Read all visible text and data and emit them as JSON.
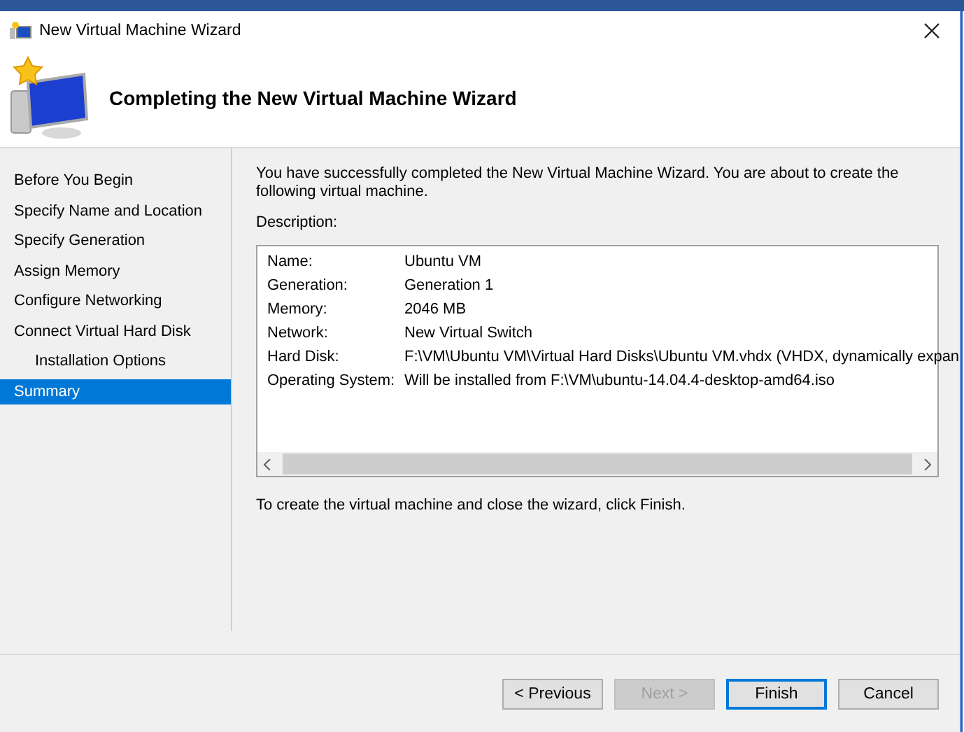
{
  "window": {
    "title": "New Virtual Machine Wizard"
  },
  "header": {
    "title": "Completing the New Virtual Machine Wizard"
  },
  "steps": [
    {
      "label": "Before You Begin",
      "selected": false
    },
    {
      "label": "Specify Name and Location",
      "selected": false
    },
    {
      "label": "Specify Generation",
      "selected": false
    },
    {
      "label": "Assign Memory",
      "selected": false
    },
    {
      "label": "Configure Networking",
      "selected": false
    },
    {
      "label": "Connect Virtual Hard Disk",
      "selected": false,
      "children": [
        {
          "label": "Installation Options",
          "selected": false
        }
      ]
    },
    {
      "label": "Summary",
      "selected": true
    }
  ],
  "intro": "You have successfully completed the New Virtual Machine Wizard. You are about to create the following virtual machine.",
  "description": {
    "label": "Description:",
    "rows": [
      {
        "label": "Name:",
        "value": "Ubuntu VM"
      },
      {
        "label": "Generation:",
        "value": "Generation 1"
      },
      {
        "label": "Memory:",
        "value": "2046 MB"
      },
      {
        "label": "Network:",
        "value": "New Virtual Switch"
      },
      {
        "label": "Hard Disk:",
        "value": "F:\\VM\\Ubuntu VM\\Virtual Hard Disks\\Ubuntu VM.vhdx (VHDX, dynamically expan"
      },
      {
        "label": "Operating System:",
        "value": "Will be installed from F:\\VM\\ubuntu-14.04.4-desktop-amd64.iso"
      }
    ]
  },
  "footer_text": "To create the virtual machine and close the wizard, click Finish.",
  "buttons": [
    {
      "label": "< Previous",
      "disabled": false,
      "focused": false
    },
    {
      "label": "Next >",
      "disabled": true,
      "focused": false
    },
    {
      "label": "Finish",
      "disabled": false,
      "focused": true
    },
    {
      "label": "Cancel",
      "disabled": false,
      "focused": false
    }
  ]
}
